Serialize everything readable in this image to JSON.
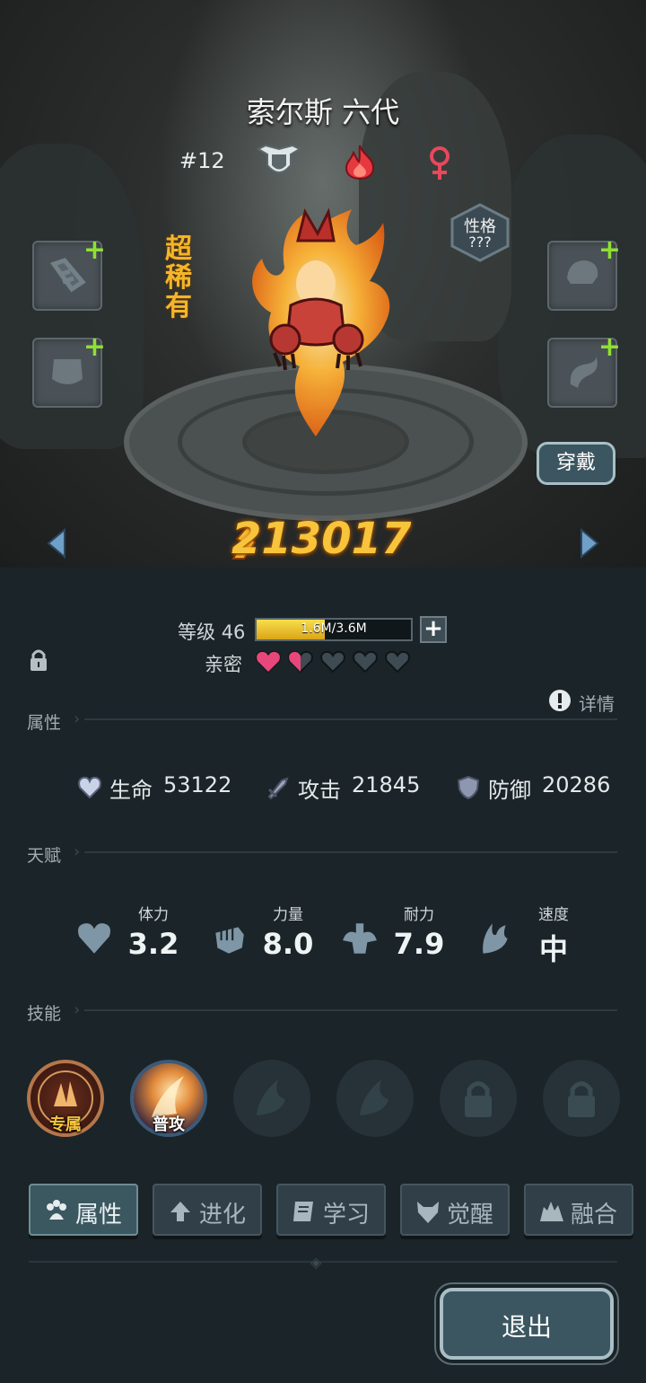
{
  "hero": {
    "name": "索尔斯 六代",
    "number": "#12",
    "rarity": "超稀有",
    "personality_label": "性格",
    "personality_value": "???",
    "power": "213017"
  },
  "actions": {
    "wear": "穿戴",
    "exit": "退出",
    "details": "详情"
  },
  "level": {
    "label": "等级",
    "value": "46",
    "exp_text": "1.6M/3.6M",
    "exp_fraction": 0.44
  },
  "intimacy": {
    "label": "亲密",
    "hearts_total": 5,
    "hearts_filled": 1.5
  },
  "sections": {
    "attributes": "属性",
    "talent": "天赋",
    "skills": "技能"
  },
  "attributes": [
    {
      "icon": "heart-shield-icon",
      "label": "生命",
      "value": "53122"
    },
    {
      "icon": "sword-icon",
      "label": "攻击",
      "value": "21845"
    },
    {
      "icon": "shield-icon",
      "label": "防御",
      "value": "20286"
    }
  ],
  "talents": [
    {
      "icon": "heart-icon",
      "label": "体力",
      "value": "3.2"
    },
    {
      "icon": "fist-icon",
      "label": "力量",
      "value": "8.0"
    },
    {
      "icon": "muscle-icon",
      "label": "耐力",
      "value": "7.9"
    },
    {
      "icon": "wing-icon",
      "label": "速度",
      "value": "中"
    }
  ],
  "skills": [
    {
      "label": "专属",
      "state": "unlocked"
    },
    {
      "label": "普攻",
      "state": "unlocked"
    },
    {
      "label": "",
      "state": "empty"
    },
    {
      "label": "",
      "state": "empty"
    },
    {
      "label": "",
      "state": "locked"
    },
    {
      "label": "",
      "state": "locked"
    }
  ],
  "tabs": [
    {
      "label": "属性",
      "icon": "paw-icon",
      "active": true
    },
    {
      "label": "进化",
      "icon": "up-arrow-icon",
      "active": false
    },
    {
      "label": "学习",
      "icon": "book-icon",
      "active": false
    },
    {
      "label": "觉醒",
      "icon": "beast-icon",
      "active": false
    },
    {
      "label": "融合",
      "icon": "fusion-icon",
      "active": false
    }
  ],
  "colors": {
    "gold": "#f7c43b",
    "plus_green": "#8fe032",
    "heart_pink": "#e7477a",
    "panel_bg": "#1b2428"
  }
}
